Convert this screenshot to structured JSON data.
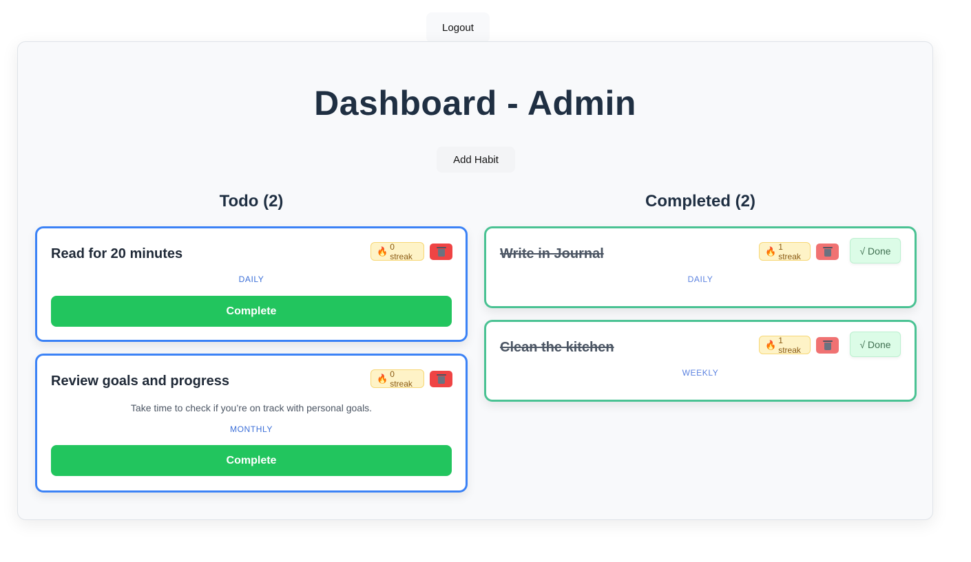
{
  "header": {
    "logout_label": "Logout"
  },
  "dashboard": {
    "title": "Dashboard - Admin",
    "add_habit_label": "Add Habit"
  },
  "todo": {
    "heading": "Todo (2)",
    "habits": [
      {
        "title": "Read for 20 minutes",
        "streak": "0 streak",
        "frequency": "DAILY",
        "description": "",
        "complete_label": "Complete"
      },
      {
        "title": "Review goals and progress",
        "streak": "0 streak",
        "frequency": "MONTHLY",
        "description": "Take time to check if you’re on track with personal goals.",
        "complete_label": "Complete"
      }
    ]
  },
  "completed": {
    "heading": "Completed (2)",
    "habits": [
      {
        "title": "Write in Journal",
        "streak": "1 streak",
        "frequency": "DAILY",
        "done_label": "√ Done"
      },
      {
        "title": "Clean the kitchen",
        "streak": "1 streak",
        "frequency": "WEEKLY",
        "done_label": "√ Done"
      }
    ]
  },
  "icons": {
    "streak": "flame-icon",
    "delete": "trash-icon"
  },
  "colors": {
    "todo_border": "#3b82f6",
    "completed_border": "#4ac293",
    "complete_button": "#22c55e",
    "delete_button": "#ef4444"
  }
}
